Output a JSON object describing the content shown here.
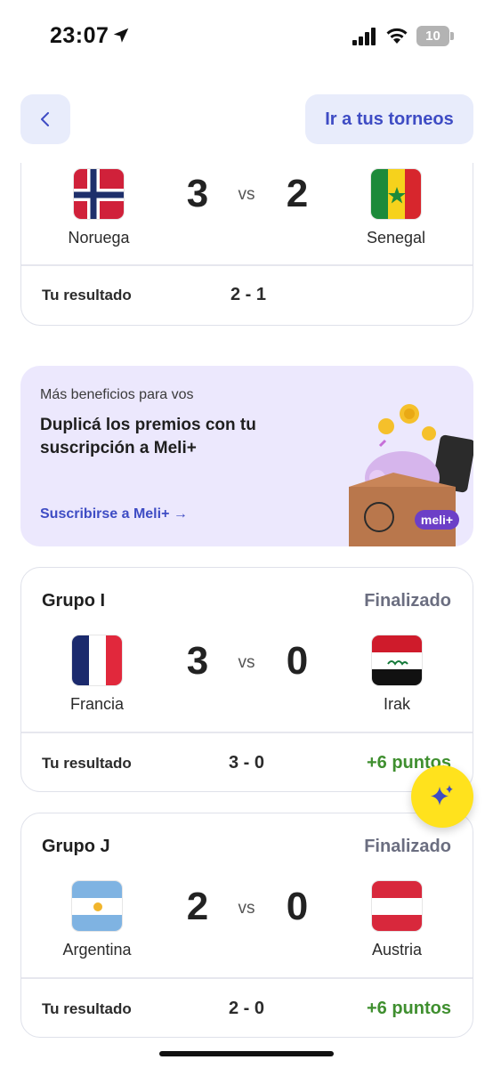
{
  "status_bar": {
    "time": "23:07",
    "battery": "10"
  },
  "nav": {
    "tournaments_label": "Ir a tus torneos"
  },
  "matches": [
    {
      "group": "",
      "status": "",
      "home": {
        "name": "Noruega",
        "score": "3"
      },
      "away": {
        "name": "Senegal",
        "score": "2"
      },
      "vs": "vs",
      "result_label": "Tu resultado",
      "result": "2  -  1",
      "points": ""
    },
    {
      "group": "Grupo I",
      "status": "Finalizado",
      "home": {
        "name": "Francia",
        "score": "3"
      },
      "away": {
        "name": "Irak",
        "score": "0"
      },
      "vs": "vs",
      "result_label": "Tu resultado",
      "result": "3  -  0",
      "points": "+6 puntos"
    },
    {
      "group": "Grupo J",
      "status": "Finalizado",
      "home": {
        "name": "Argentina",
        "score": "2"
      },
      "away": {
        "name": "Austria",
        "score": "0"
      },
      "vs": "vs",
      "result_label": "Tu resultado",
      "result": "2  -  0",
      "points": "+6 puntos"
    }
  ],
  "promo": {
    "kicker": "Más beneficios para vos",
    "title": "Duplicá los premios con tu suscripción a Meli+",
    "link": "Suscribirse a Meli+ →",
    "badge": "meli+"
  },
  "colors": {
    "accent": "#3e4cc4",
    "points": "#3f8f2f",
    "fab": "#ffe21d"
  }
}
